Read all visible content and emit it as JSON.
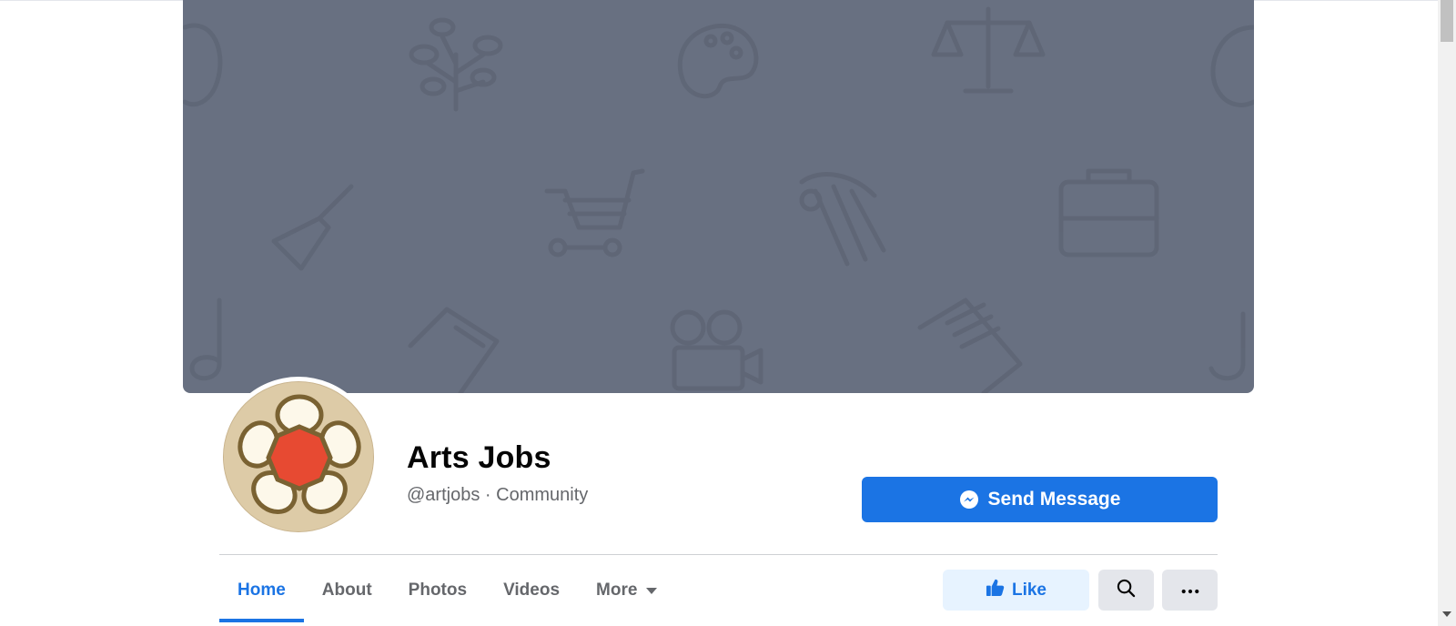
{
  "page": {
    "name": "Arts Jobs",
    "handle": "@artjobs",
    "separator": " · ",
    "category": "Community"
  },
  "actions": {
    "send_message_label": "Send Message",
    "like_label": "Like"
  },
  "tabs": [
    {
      "label": "Home",
      "active": true
    },
    {
      "label": "About",
      "active": false
    },
    {
      "label": "Photos",
      "active": false
    },
    {
      "label": "Videos",
      "active": false
    },
    {
      "label": "More",
      "active": false,
      "has_dropdown": true
    }
  ],
  "icons": {
    "send_message": "messenger-icon",
    "like": "thumbs-up-icon",
    "search": "search-icon",
    "more": "ellipsis-icon"
  },
  "colors": {
    "accent": "#1b74e4",
    "cover": "#687081",
    "like_bg": "#e7f3ff",
    "secondary_bg": "#e4e6eb"
  }
}
